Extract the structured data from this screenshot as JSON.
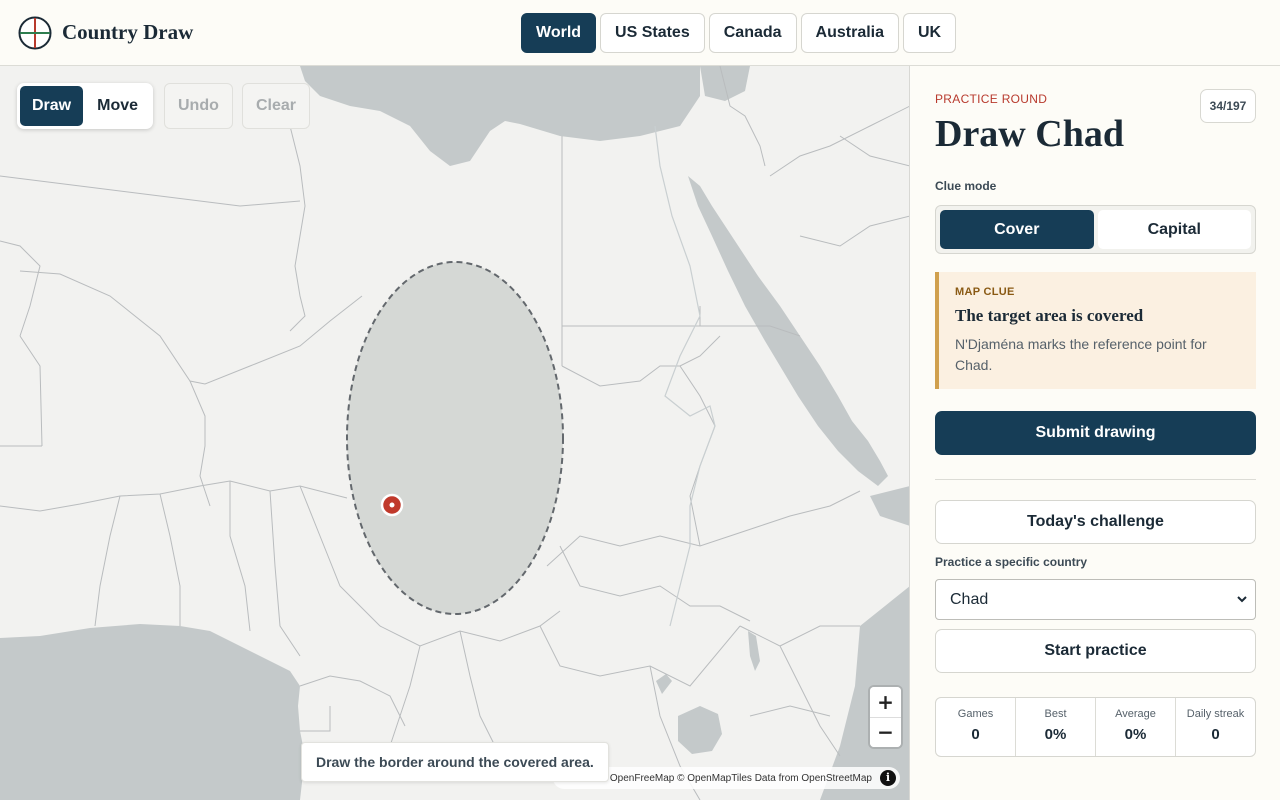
{
  "app": {
    "brand": "Country Draw",
    "logo_icon": "flag-globe-icon"
  },
  "nav": {
    "tabs": [
      {
        "label": "World",
        "active": true
      },
      {
        "label": "US States",
        "active": false
      },
      {
        "label": "Canada",
        "active": false
      },
      {
        "label": "Australia",
        "active": false
      },
      {
        "label": "UK",
        "active": false
      }
    ]
  },
  "map": {
    "tools": {
      "draw_label": "Draw",
      "move_label": "Move",
      "undo_label": "Undo",
      "clear_label": "Clear",
      "active_tool": "Draw"
    },
    "zoom_in_label": "+",
    "zoom_out_label": "−",
    "attribution": "OpenFreeMap © OpenMapTiles Data from OpenStreetMap",
    "info_label": "i",
    "hint": "Draw the border around the covered area.",
    "colors": {
      "land": "#f2f2f0",
      "water": "#c4c9ca",
      "border": "#b9bcbe",
      "cover": "#d4d7d4",
      "marker": "#c0392b"
    }
  },
  "sidebar": {
    "eyebrow": "PRACTICE ROUND",
    "counter": "34/197",
    "title": "Draw Chad",
    "clue_mode_label": "Clue mode",
    "clue_modes": {
      "cover": "Cover",
      "capital": "Capital",
      "selected": "Cover"
    },
    "clue": {
      "eyebrow": "MAP CLUE",
      "title": "The target area is covered",
      "text": "N'Djaména marks the reference point for Chad."
    },
    "submit_label": "Submit drawing",
    "challenge_label": "Today's challenge",
    "practice_label": "Practice a specific country",
    "country_selected": "Chad",
    "start_label": "Start practice",
    "stats": [
      {
        "label": "Games",
        "value": "0"
      },
      {
        "label": "Best",
        "value": "0%"
      },
      {
        "label": "Average",
        "value": "0%"
      },
      {
        "label": "Daily streak",
        "value": "0"
      }
    ],
    "colors": {
      "primary": "#163d56",
      "accent": "#b83a2e",
      "clue_bg": "#fbf0e1",
      "clue_border": "#d0a04e"
    }
  }
}
